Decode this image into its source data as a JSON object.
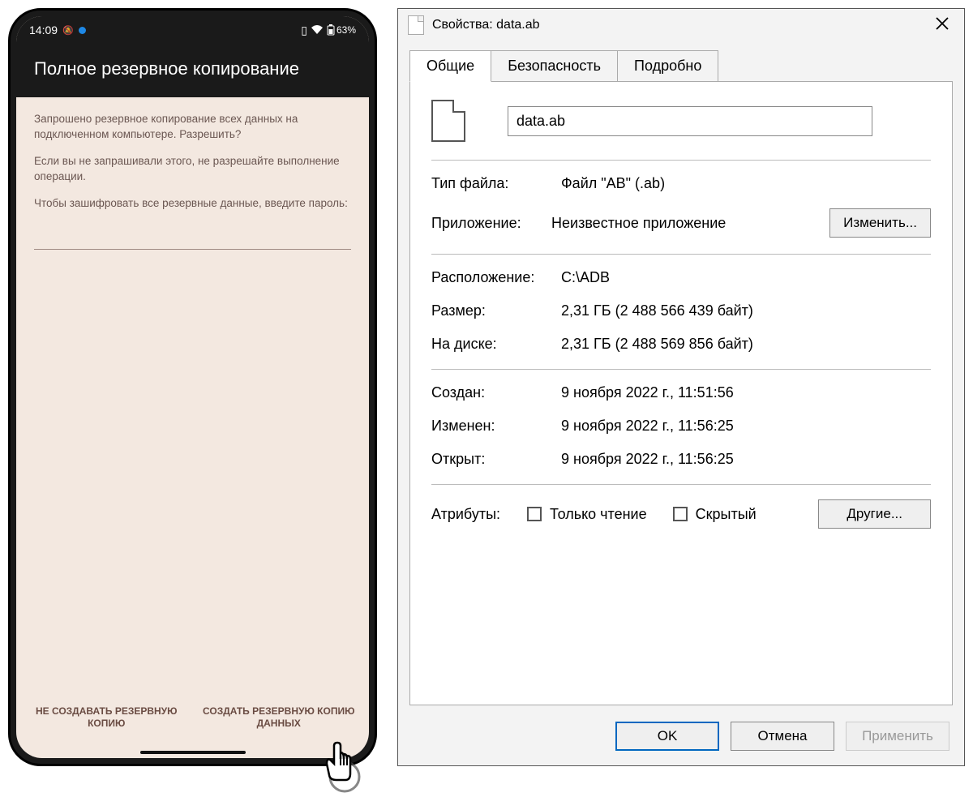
{
  "phone": {
    "status": {
      "time": "14:09",
      "battery": "63%"
    },
    "header": "Полное резервное копирование",
    "body": {
      "p1": "Запрошено резервное копирование всех данных на подключенном компьютере. Разрешить?",
      "p2": "Если вы не запрашивали этого, не разрешайте выполнение операции.",
      "p3": "Чтобы зашифровать все резервные данные, введите пароль:"
    },
    "actions": {
      "deny": "НЕ СОЗДАВАТЬ РЕЗЕРВНУЮ КОПИЮ",
      "allow": "СОЗДАТЬ РЕЗЕРВНУЮ КОПИЮ ДАННЫХ"
    }
  },
  "props": {
    "title": "Свойства: data.ab",
    "tabs": {
      "general": "Общие",
      "security": "Безопасность",
      "details": "Подробно"
    },
    "filename": "data.ab",
    "rows": {
      "type_label": "Тип файла:",
      "type_value": "Файл \"AB\" (.ab)",
      "app_label": "Приложение:",
      "app_value": "Неизвестное приложение",
      "change_btn": "Изменить...",
      "location_label": "Расположение:",
      "location_value": "C:\\ADB",
      "size_label": "Размер:",
      "size_value": "2,31 ГБ (2 488 566 439 байт)",
      "sizedisk_label": "На диске:",
      "sizedisk_value": "2,31 ГБ (2 488 569 856 байт)",
      "created_label": "Создан:",
      "created_value": "9 ноября 2022 г., 11:51:56",
      "modified_label": "Изменен:",
      "modified_value": "9 ноября 2022 г., 11:56:25",
      "accessed_label": "Открыт:",
      "accessed_value": "9 ноября 2022 г., 11:56:25",
      "attrs_label": "Атрибуты:",
      "attr_readonly": "Только чтение",
      "attr_hidden": "Скрытый",
      "other_btn": "Другие..."
    },
    "footer": {
      "ok": "OK",
      "cancel": "Отмена",
      "apply": "Применить"
    }
  }
}
